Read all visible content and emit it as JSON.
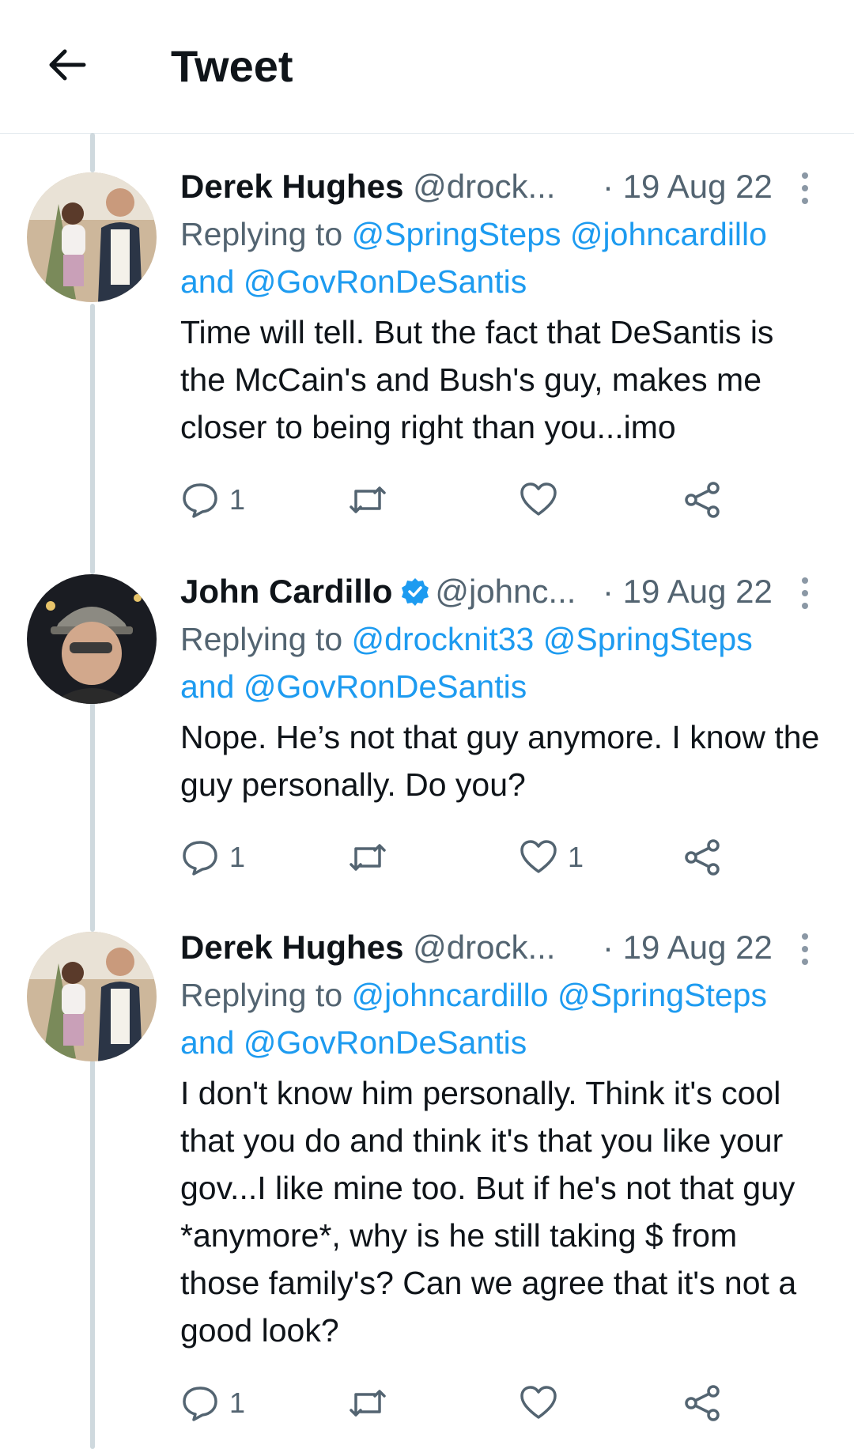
{
  "header": {
    "title": "Tweet",
    "back_icon": "arrow-left-icon"
  },
  "colors": {
    "link": "#1d9bf0",
    "secondary": "#536471",
    "thread_line": "#cfd9de",
    "verified": "#1d9bf0"
  },
  "tweets": [
    {
      "name": "Derek Hughes",
      "handle": "@drock...",
      "date": "· 19 Aug 22",
      "verified": false,
      "replying_prefix": "Replying to",
      "reply_mentions": [
        "@SpringSteps",
        "@johncardillo"
      ],
      "reply_and": "and",
      "reply_last": "@GovRonDeSantis",
      "text": "Time will tell. But the fact that DeSantis is the McCain's and Bush's guy, makes me closer to being right than you...imo",
      "reply_count": "1",
      "retweet_count": "",
      "like_count": ""
    },
    {
      "name": "John Cardillo",
      "handle": "@johnc...",
      "date": "· 19 Aug 22",
      "verified": true,
      "replying_prefix": "Replying to",
      "reply_mentions": [
        "@drocknit33",
        "@SpringSteps"
      ],
      "reply_and": "and",
      "reply_last": "@GovRonDeSantis",
      "text": "Nope. He’s not that guy anymore. I know the guy personally. Do you?",
      "reply_count": "1",
      "retweet_count": "",
      "like_count": "1"
    },
    {
      "name": "Derek Hughes",
      "handle": "@drock...",
      "date": "· 19 Aug 22",
      "verified": false,
      "replying_prefix": "Replying to",
      "reply_mentions": [
        "@johncardillo",
        "@SpringSteps"
      ],
      "reply_and": "and",
      "reply_last": "@GovRonDeSantis",
      "text": "I don't know him personally. Think it's cool that you do and think it's that you like your gov...I like mine too. But if he's not that guy *anymore*, why is he still taking $ from those family's? Can we agree that it's not a good look?",
      "reply_count": "1",
      "retweet_count": "",
      "like_count": ""
    }
  ]
}
